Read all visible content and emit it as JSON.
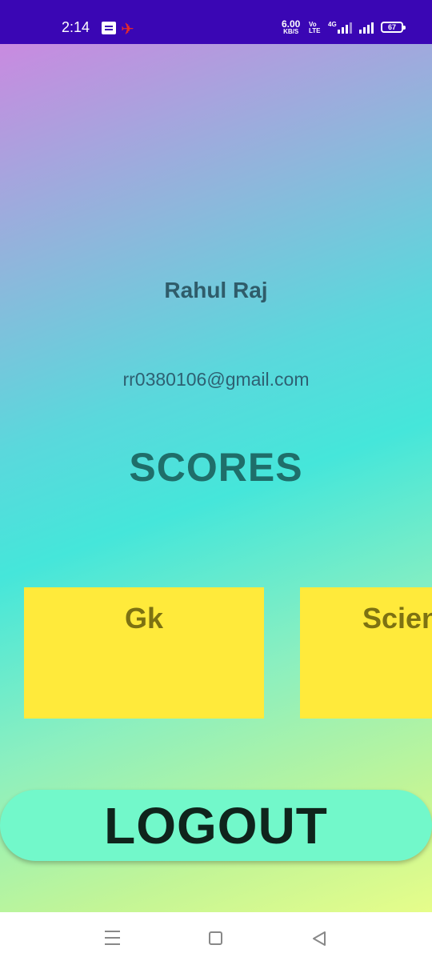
{
  "status_bar": {
    "time": "2:14",
    "speed_value": "6.00",
    "speed_unit": "KB/S",
    "volte_top": "Vo",
    "volte_bottom": "LTE",
    "network": "4G",
    "battery": "67"
  },
  "profile": {
    "name": "Rahul Raj",
    "email": "rr0380106@gmail.com"
  },
  "scores": {
    "title": "SCORES",
    "cards": [
      {
        "label": "Gk"
      },
      {
        "label": "Science"
      }
    ]
  },
  "actions": {
    "logout_label": "LOGOUT"
  },
  "colors": {
    "status_bar": "#3a06b4",
    "card": "#ffea3b",
    "logout_button": "#72f8ca"
  },
  "icons": {
    "nav": [
      "menu-icon",
      "home-icon",
      "back-icon"
    ]
  }
}
